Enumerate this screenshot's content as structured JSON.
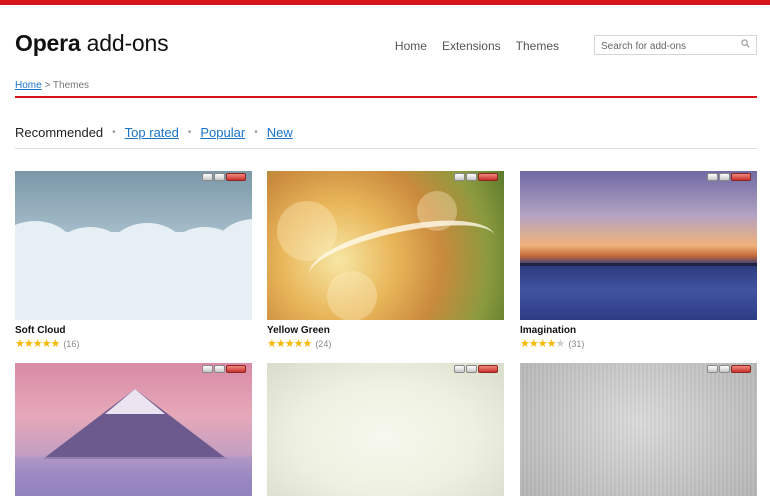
{
  "brand": {
    "bold": "Opera",
    "rest": " add-ons",
    "accent_color": "#d7141a",
    "link_color": "#1a73c9"
  },
  "nav": {
    "items": [
      "Home",
      "Extensions",
      "Themes"
    ]
  },
  "search": {
    "placeholder": "Search for add-ons",
    "icon": "search-icon"
  },
  "breadcrumb": {
    "home": "Home",
    "sep": " > ",
    "current": "Themes"
  },
  "filters": {
    "current": "Recommended",
    "dot": "•",
    "links": [
      "Top rated",
      "Popular",
      "New"
    ]
  },
  "themes": [
    {
      "name": "Soft Cloud",
      "rating": 4.5,
      "count": "(16)"
    },
    {
      "name": "Yellow Green",
      "rating": 4.5,
      "count": "(24)"
    },
    {
      "name": "Imagination",
      "rating": 4,
      "count": "(31)"
    },
    {
      "name": "",
      "rating": null,
      "count": ""
    },
    {
      "name": "",
      "rating": null,
      "count": ""
    },
    {
      "name": "",
      "rating": null,
      "count": ""
    }
  ]
}
